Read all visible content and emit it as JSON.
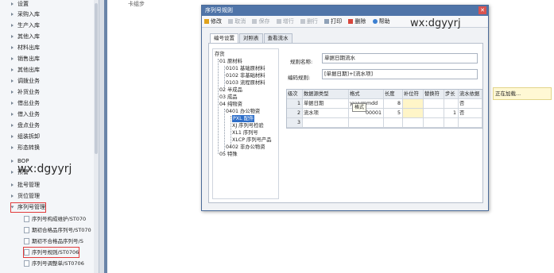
{
  "nav": {
    "items": [
      "设置",
      "采购入库",
      "生产入库",
      "其他入库",
      "材料出库",
      "销售出库",
      "其他出库",
      "调拨业务",
      "补货业务",
      "借出业务",
      "借入业务",
      "盘点业务",
      "组装拆卸",
      "形态转换",
      "BOP",
      "预警",
      "批号管理",
      "货位管理",
      "序列号管理"
    ],
    "sub_items": [
      "序列号构成维护/ST070",
      "期初合格品序列号/ST070",
      "期初不合格品序列号/S",
      "序列号规则/ST0706",
      "序列号调整单/ST0706"
    ]
  },
  "main": {
    "heading": "卡组步",
    "loading": "正在加载..."
  },
  "watermarks": {
    "left": "wx:dgyyrj",
    "right": "wx:dgyyrj"
  },
  "dialog": {
    "title": "序列号规则",
    "close": "✕",
    "toolbar": [
      "修改",
      "取消",
      "保存",
      "增行",
      "删行",
      "打印",
      "删除",
      "帮助"
    ],
    "tabs": [
      "编号设置",
      "对照表",
      "查看流水"
    ],
    "tree": {
      "root": "存货",
      "nodes": [
        "01 原材料",
        "0101 基础原材料",
        "0102 非基础材料",
        "0103 流程原材料",
        "02 半成品",
        "03 成品",
        "04 纯物资",
        "0401 办公物资",
        "PXL 配件",
        "XJ 序列号检验",
        "XL1 序列号",
        "XLCP 序列号产品",
        "0402 非办公物资",
        "05 特殊"
      ]
    },
    "form": {
      "name_label": "规则名称:",
      "name_value": "单据日期流水",
      "rule_label": "编码规则:",
      "rule_value": "[单据日期]+[流水项]"
    },
    "grid": {
      "headers": [
        "级次",
        "数据源类型",
        "格式",
        "长度",
        "补位符",
        "替换符",
        "步长",
        "流水依据"
      ],
      "rows": [
        [
          "1",
          "单据日期",
          "yyyymmdd",
          "8",
          "",
          "",
          "",
          "否"
        ],
        [
          "2",
          "流水项",
          "00001",
          "5",
          "",
          "",
          "1",
          "否"
        ],
        [
          "3",
          "",
          "",
          "",
          "",
          "",
          "",
          ""
        ]
      ],
      "tooltip": "格式"
    }
  }
}
